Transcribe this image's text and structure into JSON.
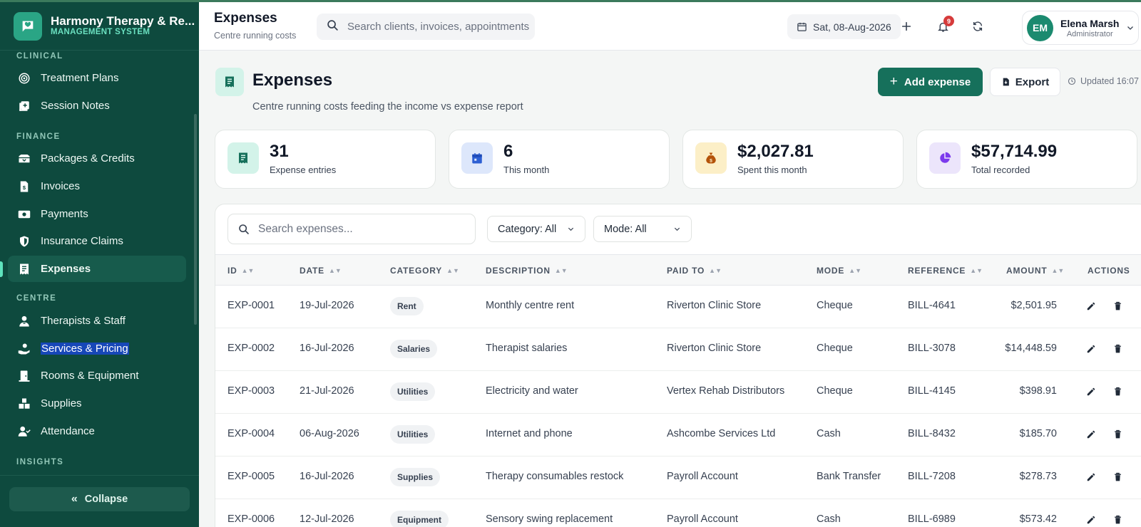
{
  "brand": {
    "title": "Harmony Therapy & Re...",
    "subtitle": "MANAGEMENT SYSTEM"
  },
  "sidebar": {
    "sections": [
      {
        "label": "CLINICAL"
      },
      {
        "label": "FINANCE"
      },
      {
        "label": "CENTRE"
      },
      {
        "label": "INSIGHTS"
      }
    ],
    "items": [
      {
        "label": "Treatment Plans",
        "icon": "target-icon"
      },
      {
        "label": "Session Notes",
        "icon": "note-add-icon"
      },
      {
        "label": "Packages & Credits",
        "icon": "package-icon"
      },
      {
        "label": "Invoices",
        "icon": "invoice-icon"
      },
      {
        "label": "Payments",
        "icon": "cash-icon"
      },
      {
        "label": "Insurance Claims",
        "icon": "shield-icon"
      },
      {
        "label": "Expenses",
        "icon": "receipt-icon",
        "active": true
      },
      {
        "label": "Therapists & Staff",
        "icon": "staff-icon"
      },
      {
        "label": "Services & Pricing",
        "icon": "hand-coin-icon",
        "selected_text": true
      },
      {
        "label": "Rooms & Equipment",
        "icon": "door-icon"
      },
      {
        "label": "Supplies",
        "icon": "boxes-icon"
      },
      {
        "label": "Attendance",
        "icon": "user-check-icon"
      }
    ],
    "collapse_label": "Collapse"
  },
  "header": {
    "title": "Expenses",
    "subtitle": "Centre running costs",
    "search_placeholder": "Search clients, invoices, appointments",
    "date": "Sat, 08-Aug-2026",
    "notification_count": "9",
    "user": {
      "initials": "EM",
      "name": "Elena Marsh",
      "role": "Administrator"
    }
  },
  "page": {
    "title": "Expenses",
    "subtitle": "Centre running costs feeding the income vs expense report",
    "add_label": "Add expense",
    "export_label": "Export",
    "updated": "Updated 16:07"
  },
  "stats": [
    {
      "value": "31",
      "label": "Expense entries",
      "icon": "receipt-icon",
      "bg": "#d3f3e9",
      "fg": "#16705b"
    },
    {
      "value": "6",
      "label": "This month",
      "icon": "calendar-icon",
      "bg": "#dde7fb",
      "fg": "#2d5fd3"
    },
    {
      "value": "$2,027.81",
      "label": "Spent this month",
      "icon": "money-bag-icon",
      "bg": "#fcefc7",
      "fg": "#b45309"
    },
    {
      "value": "$57,714.99",
      "label": "Total recorded",
      "icon": "pie-chart-icon",
      "bg": "#ece5fb",
      "fg": "#7c3aed"
    }
  ],
  "table": {
    "search_placeholder": "Search expenses...",
    "filters": [
      "Category: All",
      "Mode: All"
    ],
    "columns": [
      "ID",
      "DATE",
      "CATEGORY",
      "DESCRIPTION",
      "PAID TO",
      "MODE",
      "REFERENCE",
      "AMOUNT",
      "ACTIONS"
    ],
    "rows": [
      {
        "id": "EXP-0001",
        "date": "19-Jul-2026",
        "category": "Rent",
        "description": "Monthly centre rent",
        "paid_to": "Riverton Clinic Store",
        "mode": "Cheque",
        "reference": "BILL-4641",
        "amount": "$2,501.95"
      },
      {
        "id": "EXP-0002",
        "date": "16-Jul-2026",
        "category": "Salaries",
        "description": "Therapist salaries",
        "paid_to": "Riverton Clinic Store",
        "mode": "Cheque",
        "reference": "BILL-3078",
        "amount": "$14,448.59"
      },
      {
        "id": "EXP-0003",
        "date": "21-Jul-2026",
        "category": "Utilities",
        "description": "Electricity and water",
        "paid_to": "Vertex Rehab Distributors",
        "mode": "Cheque",
        "reference": "BILL-4145",
        "amount": "$398.91"
      },
      {
        "id": "EXP-0004",
        "date": "06-Aug-2026",
        "category": "Utilities",
        "description": "Internet and phone",
        "paid_to": "Ashcombe Services Ltd",
        "mode": "Cash",
        "reference": "BILL-8432",
        "amount": "$185.70"
      },
      {
        "id": "EXP-0005",
        "date": "16-Jul-2026",
        "category": "Supplies",
        "description": "Therapy consumables restock",
        "paid_to": "Payroll Account",
        "mode": "Bank Transfer",
        "reference": "BILL-7208",
        "amount": "$278.73"
      },
      {
        "id": "EXP-0006",
        "date": "12-Jul-2026",
        "category": "Equipment",
        "description": "Sensory swing replacement",
        "paid_to": "Payroll Account",
        "mode": "Cash",
        "reference": "BILL-6989",
        "amount": "$573.42"
      }
    ]
  },
  "colors": {
    "sidebar": "#0e4a3e",
    "accent": "#16705b",
    "active_item": "#175b4c"
  }
}
